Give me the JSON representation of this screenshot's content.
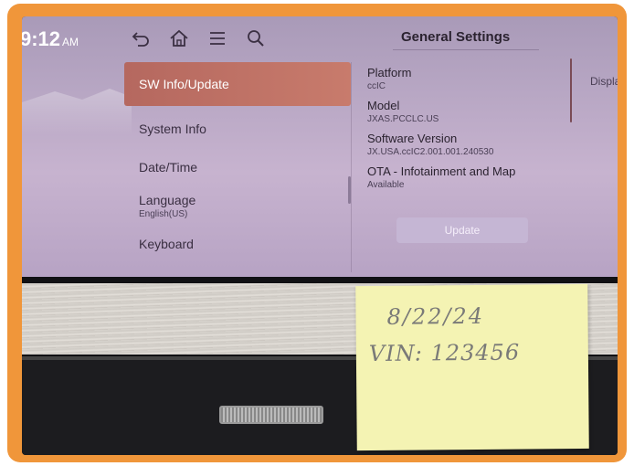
{
  "status": {
    "time": "9:12",
    "ampm": "AM"
  },
  "screen": {
    "title": "General Settings"
  },
  "menu": {
    "items": [
      {
        "label": "SW Info/Update",
        "sub": ""
      },
      {
        "label": "System Info",
        "sub": ""
      },
      {
        "label": "Date/Time",
        "sub": ""
      },
      {
        "label": "Language",
        "sub": "English(US)"
      },
      {
        "label": "Keyboard",
        "sub": ""
      }
    ]
  },
  "details": [
    {
      "label": "Platform",
      "value": "ccIC"
    },
    {
      "label": "Model",
      "value": "JXAS.PCCLC.US"
    },
    {
      "label": "Software Version",
      "value": "JX.USA.ccIC2.001.001.240530"
    },
    {
      "label": "OTA - Infotainment and Map",
      "value": "Available"
    }
  ],
  "update_button": "Update",
  "right_peek": "Displa",
  "sticky_note": {
    "date": "8/22/24",
    "vin": "VIN: 123456"
  },
  "colors": {
    "frame": "#f0963a",
    "active_item": "#b5685f",
    "screen": "#b8a7c4"
  },
  "icons": [
    "back-icon",
    "home-icon",
    "menu-icon",
    "search-icon"
  ]
}
